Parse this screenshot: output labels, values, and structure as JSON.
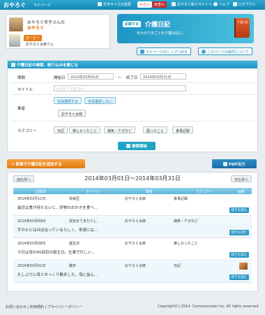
{
  "header": {
    "brand": "おやろぐ",
    "brand_sub": "マイページ",
    "font_size_label": "文字サイズの変更",
    "size_small": "小さい",
    "size_large": "大きい",
    "top_link": "おやろぐ新介サイトへ",
    "help": "ヘルプ",
    "logout": "ログアウト"
  },
  "profile": {
    "senior_name": "おやろぐ市子さんの",
    "nickname": "おやろぐ",
    "owner_badge": "オーナー",
    "owner_name": "おやろぐ太郎さん"
  },
  "banner": {
    "badge": "記録する",
    "title": "介護日記",
    "description": "日々のできごとを介護日記に。",
    "book_label": "介護日記"
  },
  "links": {
    "mypage_top": "マイページのトップへ戻る",
    "about_page": "このページの操作について"
  },
  "search": {
    "heading": "介護日記の検索、絞り込みを開じる",
    "period_label": "期間",
    "start_label": "開始日",
    "start_value": "2014年03月01日",
    "tilde": "〜",
    "end_label": "終了日",
    "end_value": "2014年03月31日",
    "title_label": "タイトル",
    "title_placeholder": "入力してください",
    "author_label": "筆者",
    "select_all": "全員選択する",
    "deselect_all": "全員選択しない",
    "author_chip": "おやろぐ太郎",
    "category_label": "カテゴリー",
    "categories": [
      "日記",
      "楽しかったこと",
      "病気・ケガなど",
      "困ったこと",
      "食事記録"
    ],
    "search_button": "検索開始"
  },
  "actions": {
    "add_diary": "+ 新規で介護日記を追加する",
    "pdf": "PDF出力"
  },
  "list": {
    "prev": "前の月へ",
    "next": "次の月へ",
    "period": "2014年03月01日〜2014年03月31日",
    "columns": [
      "記録日",
      "タイトル",
      "筆者",
      "カテゴリー",
      "画像"
    ],
    "read_more": "続きを読む",
    "entries": [
      {
        "date": "2014年03月11日",
        "title": "甘納豆",
        "author": "おやろぐ太郎",
        "category": "食事記録",
        "body": "最近は食が持たないと、好物のおかきを食べ..."
      },
      {
        "date": "2014年03月09日",
        "title": "完治までまだ少し",
        "author": "おやろぐ太郎",
        "category": "病気・ケガなど",
        "body": "手のヒビはほぼ治っているらしく、来週には..."
      },
      {
        "date": "2014年03月08日",
        "title": "誕生日",
        "author": "おやろぐ太郎",
        "category": "楽しかったこと",
        "body": "今日は母の85回目の誕生日。仕事で忙しい..."
      },
      {
        "date": "2014年03月01日",
        "title": "散歩",
        "author": "おやろぐ太郎",
        "category": "日記",
        "body": "久しぶりに母とゆっくり散歩した。母に益ん..."
      }
    ]
  },
  "footer": {
    "contact": "お問い合わせ",
    "terms": "利用規約",
    "privacy": "プライバシーポリシー",
    "separator": "|",
    "copyright": "Copyright(C) 2014- Communicator Inc. All rights reserved."
  }
}
